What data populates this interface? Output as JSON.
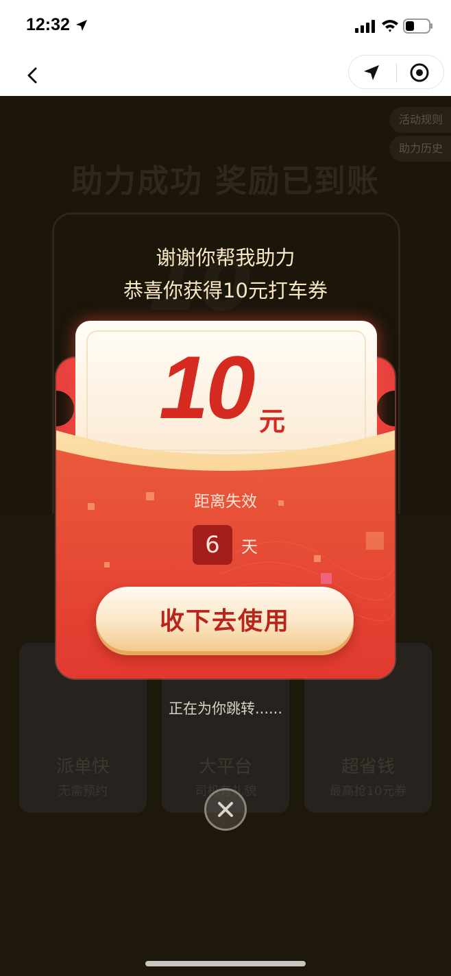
{
  "status_bar": {
    "time": "12:32"
  },
  "background": {
    "pills": {
      "rules": "活动规则",
      "history": "助力历史"
    },
    "headline": "助力成功 奖励已到账",
    "big_number": "10",
    "features": [
      {
        "title": "派单快",
        "subtitle": "无需预约"
      },
      {
        "title": "大平台",
        "subtitle": "司机有礼貌"
      },
      {
        "title": "超省钱",
        "subtitle": "最高抢10元券"
      }
    ]
  },
  "modal": {
    "title_line1": "谢谢你帮我助力",
    "title_line2": "恭喜你获得10元打车券",
    "amount": "10",
    "amount_unit": "元",
    "expire_label": "距离失效",
    "days": "6",
    "days_unit": "天",
    "use_button": "收下去使用",
    "redirect_text": "正在为你跳转......"
  },
  "colors": {
    "accent_red": "#d42a20",
    "envelope_red": "#e23a34",
    "button_text": "#b8251c",
    "overlay_dark": "#1b150a"
  },
  "icons": {
    "status_location": "location-arrow-icon",
    "signal": "cellular-signal-icon",
    "wifi": "wifi-icon",
    "battery": "battery-icon",
    "back": "chevron-left-icon",
    "capsule_location": "navigation-arrow-icon",
    "capsule_close": "target-circle-icon",
    "modal_close": "close-icon"
  }
}
